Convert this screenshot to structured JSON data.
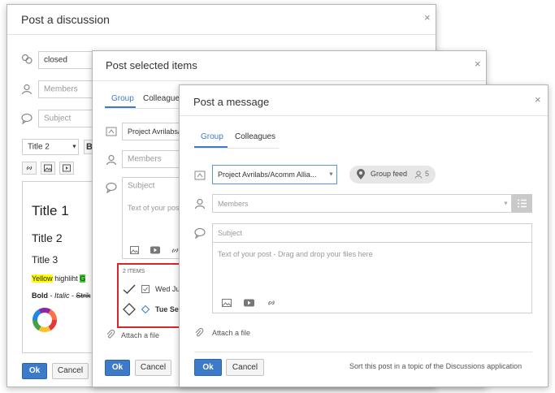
{
  "dialog1": {
    "title": "Post a discussion",
    "close": "×",
    "group_value": "closed",
    "members_placeholder": "Members",
    "subject_placeholder": "Subject",
    "style_select": "Title 2",
    "editor": {
      "title1": "Title 1",
      "title2": "Title 2",
      "title3": "Title 3",
      "yellow": "Yellow",
      "highlight_rest": " highliht ",
      "green": "G",
      "bold": "Bold",
      "dash1": " - ",
      "italic": "Italic",
      "dash2": " - ",
      "strike": "Strik"
    },
    "ok": "Ok",
    "cancel": "Cancel"
  },
  "dialog2": {
    "title": "Post selected items",
    "close": "×",
    "tabs": [
      "Group",
      "Colleagues"
    ],
    "group_value": "Project Avrilabs/A",
    "members_placeholder": "Members",
    "subject_placeholder": "Subject",
    "text_placeholder": "Text of your post -",
    "items_header": "2 ITEMS",
    "items": [
      {
        "label": "Wed Ju",
        "bold": false
      },
      {
        "label": "Tue Sep",
        "bold": true
      }
    ],
    "attach": "Attach a file",
    "ok": "Ok",
    "cancel": "Cancel"
  },
  "dialog3": {
    "title": "Post a message",
    "close": "×",
    "tabs": [
      {
        "label": "Group",
        "active": true
      },
      {
        "label": "Colleagues",
        "active": false
      }
    ],
    "group_value": "Project Avrilabs/Acomm Allia...",
    "group_feed_label": "Group feed",
    "group_feed_count": "5",
    "members_placeholder": "Members",
    "subject_placeholder": "Subject",
    "text_placeholder": "Text of your post - Drag and drop your files here",
    "attach": "Attach a file",
    "ok": "Ok",
    "cancel": "Cancel",
    "footer_note": "Sort this post in a topic of the Discussions application"
  },
  "colors": {
    "accent": "#3d7ac9",
    "highlight_red": "#d9262a",
    "yellow": "#ffff00",
    "green": "#44cc33"
  },
  "icons": [
    "group-icon",
    "person-icon",
    "comment-icon",
    "image-icon",
    "video-icon",
    "link-icon",
    "paperclip-icon",
    "checkmark-icon",
    "diamond-icon",
    "location-pin-icon",
    "list-icon",
    "chevron-down-icon",
    "close-icon"
  ]
}
